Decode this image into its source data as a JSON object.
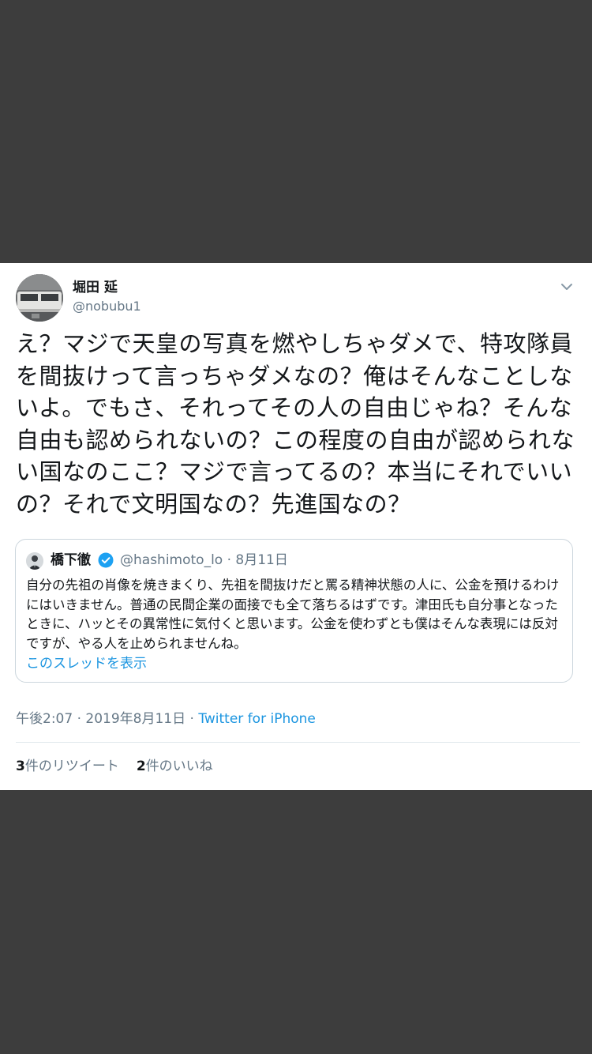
{
  "author": {
    "name": "堀田 延",
    "handle": "@nobubu1"
  },
  "tweet": {
    "text": "え？マジで天皇の写真を燃やしちゃダメで、特攻隊員を間抜けって言っちゃダメなの？俺はそんなことしないよ。でもさ、それってその人の自由じゃね？そんな自由も認められないの？この程度の自由が認められない国なのここ？マジで言ってるの？本当にそれでいいの？それで文明国なの？先進国なの？"
  },
  "quoted": {
    "name": "橋下徹",
    "handle_date": "@hashimoto_lo · 8月11日",
    "text": "自分の先祖の肖像を焼きまくり、先祖を間抜けだと罵る精神状態の人に、公金を預けるわけにはいきません。普通の民間企業の面接でも全て落ちるはずです。津田氏も自分事となったときに、ハッとその異常性に気付くと思います。公金を使わずとも僕はそんな表現には反対ですが、やる人を止められませんね。",
    "show_thread": "このスレッドを表示"
  },
  "meta": {
    "time_date": "午後2:07 · 2019年8月11日 · ",
    "source": "Twitter for iPhone"
  },
  "stats": {
    "retweets_count": "3",
    "retweets_label": "件のリツイート",
    "likes_count": "2",
    "likes_label": "件のいいね"
  },
  "icons": {
    "menu": "chevron-down-icon",
    "verified": "verified-badge-icon"
  },
  "colors": {
    "background": "#3d3d3d",
    "card": "#ffffff",
    "link": "#1b95e0",
    "verified": "#1da1f2",
    "secondary_text": "#657786",
    "primary_text": "#14171a"
  }
}
